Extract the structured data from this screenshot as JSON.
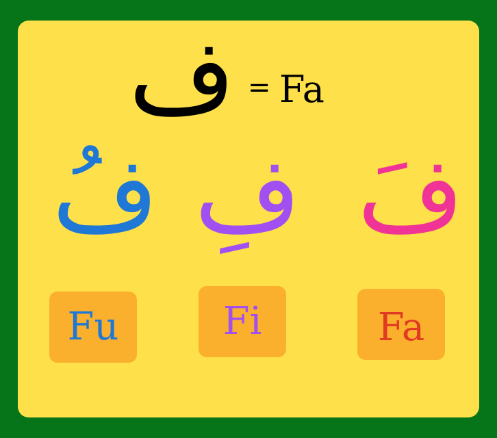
{
  "header": {
    "letter": "ف",
    "equals": "=",
    "transliteration": "Fa"
  },
  "vowels": [
    {
      "letter": "فُ",
      "label": "Fu",
      "color": "#1f78d6"
    },
    {
      "letter": "فِ",
      "label": "Fi",
      "color": "#a24ff2"
    },
    {
      "letter": "فَ",
      "label": "Fa",
      "color": "#f03396"
    }
  ],
  "label_colors": {
    "fu": "#1f78d6",
    "fi": "#a24ff2",
    "fa": "#e03a22"
  },
  "colors": {
    "border": "#06751a",
    "card": "#fee04a",
    "tile": "#fbb02d"
  }
}
